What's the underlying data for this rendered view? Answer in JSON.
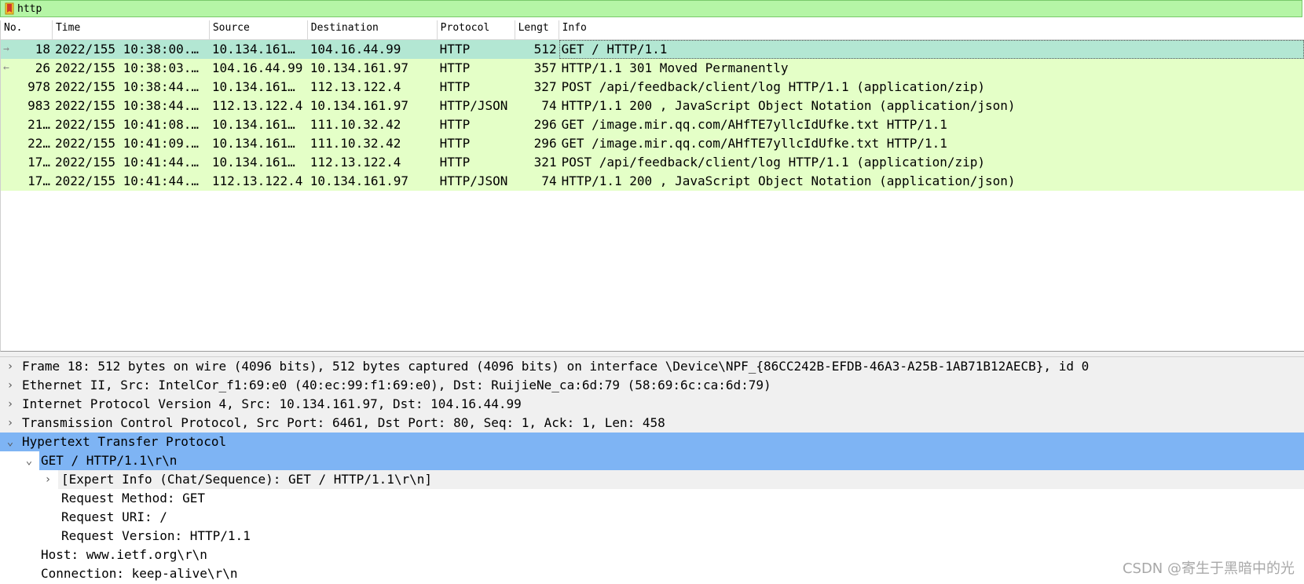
{
  "filter": {
    "value": "http"
  },
  "columns": [
    "No.",
    "Time",
    "Source",
    "Destination",
    "Protocol",
    "Lengt",
    "Info"
  ],
  "packets": [
    {
      "no": "18",
      "time": "2022/155 10:38:00.…",
      "src": "10.134.161…",
      "dst": "104.16.44.99",
      "proto": "HTTP",
      "len": "512",
      "info": "GET / HTTP/1.1",
      "arrow": "→"
    },
    {
      "no": "26",
      "time": "2022/155 10:38:03.…",
      "src": "104.16.44.99",
      "dst": "10.134.161.97",
      "proto": "HTTP",
      "len": "357",
      "info": "HTTP/1.1 301 Moved Permanently",
      "arrow": "←"
    },
    {
      "no": "978",
      "time": "2022/155 10:38:44.…",
      "src": "10.134.161…",
      "dst": "112.13.122.4",
      "proto": "HTTP",
      "len": "327",
      "info": "POST /api/feedback/client/log HTTP/1.1  (application/zip)",
      "arrow": ""
    },
    {
      "no": "983",
      "time": "2022/155 10:38:44.…",
      "src": "112.13.122.4",
      "dst": "10.134.161.97",
      "proto": "HTTP/JSON",
      "len": "74",
      "info": "HTTP/1.1 200  , JavaScript Object Notation (application/json)",
      "arrow": ""
    },
    {
      "no": "21…",
      "time": "2022/155 10:41:08.…",
      "src": "10.134.161…",
      "dst": "111.10.32.42",
      "proto": "HTTP",
      "len": "296",
      "info": "GET /image.mir.qq.com/AHfTE7yllcIdUfke.txt HTTP/1.1",
      "arrow": ""
    },
    {
      "no": "22…",
      "time": "2022/155 10:41:09.…",
      "src": "10.134.161…",
      "dst": "111.10.32.42",
      "proto": "HTTP",
      "len": "296",
      "info": "GET /image.mir.qq.com/AHfTE7yllcIdUfke.txt HTTP/1.1",
      "arrow": ""
    },
    {
      "no": "17…",
      "time": "2022/155 10:41:44.…",
      "src": "10.134.161…",
      "dst": "112.13.122.4",
      "proto": "HTTP",
      "len": "321",
      "info": "POST /api/feedback/client/log HTTP/1.1  (application/zip)",
      "arrow": ""
    },
    {
      "no": "17…",
      "time": "2022/155 10:41:44.…",
      "src": "112.13.122.4",
      "dst": "10.134.161.97",
      "proto": "HTTP/JSON",
      "len": "74",
      "info": "HTTP/1.1 200  , JavaScript Object Notation (application/json)",
      "arrow": ""
    }
  ],
  "details": [
    "Frame 18: 512 bytes on wire (4096 bits), 512 bytes captured (4096 bits) on interface \\Device\\NPF_{86CC242B-EFDB-46A3-A25B-1AB71B12AECB}, id 0",
    "Ethernet II, Src: IntelCor_f1:69:e0 (40:ec:99:f1:69:e0), Dst: RuijieNe_ca:6d:79 (58:69:6c:ca:6d:79)",
    "Internet Protocol Version 4, Src: 10.134.161.97, Dst: 104.16.44.99",
    "Transmission Control Protocol, Src Port: 6461, Dst Port: 80, Seq: 1, Ack: 1, Len: 458",
    "Hypertext Transfer Protocol",
    "GET / HTTP/1.1\\r\\n",
    "[Expert Info (Chat/Sequence): GET / HTTP/1.1\\r\\n]",
    "Request Method: GET",
    "Request URI: /",
    "Request Version: HTTP/1.1",
    "Host: www.ietf.org\\r\\n",
    "Connection: keep-alive\\r\\n"
  ],
  "watermark": "CSDN @寄生于黑暗中的光",
  "colors": {
    "filter_bg": "#b5f5a6",
    "row_bg": "#e4ffc7",
    "row_selected": "#b3e7d3",
    "tree_selected": "#7eb4f4"
  }
}
